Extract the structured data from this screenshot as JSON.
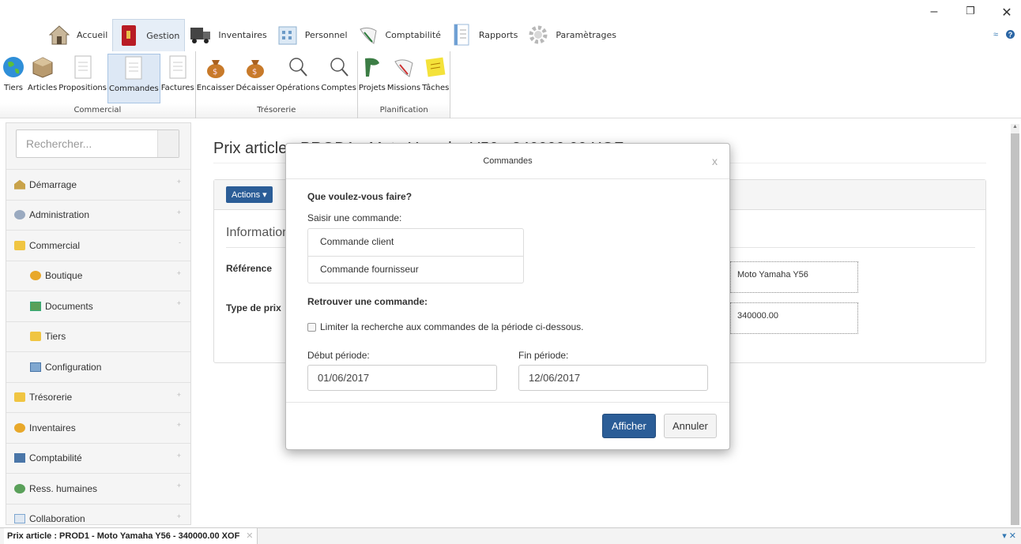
{
  "window_controls": {
    "minimize": "–",
    "restore": "❐",
    "close": "✕"
  },
  "topmenu": [
    {
      "label": "Accueil",
      "icon": "home-icon"
    },
    {
      "label": "Gestion",
      "icon": "book-icon"
    },
    {
      "label": "Inventaires",
      "icon": "truck-icon"
    },
    {
      "label": "Personnel",
      "icon": "building-icon"
    },
    {
      "label": "Comptabilité",
      "icon": "pen-icon"
    },
    {
      "label": "Rapports",
      "icon": "report-icon"
    },
    {
      "label": "Paramètrages",
      "icon": "gear-icon"
    }
  ],
  "ribbon": {
    "groups": [
      {
        "label": "Commercial",
        "buttons": [
          "Tiers",
          "Articles",
          "Propositions",
          "Commandes",
          "Factures"
        ]
      },
      {
        "label": "Trésorerie",
        "buttons": [
          "Encaisser",
          "Décaisser",
          "Opérations",
          "Comptes"
        ]
      },
      {
        "label": "Planification",
        "buttons": [
          "Projets",
          "Missions",
          "Tâches"
        ]
      }
    ],
    "selected": "Commandes"
  },
  "sidebar": {
    "search_placeholder": "Rechercher...",
    "items": [
      {
        "label": "Démarrage",
        "icon": "home-icon"
      },
      {
        "label": "Administration",
        "icon": "gear-icon"
      },
      {
        "label": "Commercial",
        "icon": "folder-icon"
      },
      {
        "label": "Boutique",
        "icon": "box-icon"
      },
      {
        "label": "Documents",
        "icon": "document-icon"
      },
      {
        "label": "Tiers",
        "icon": "folder-icon"
      },
      {
        "label": "Configuration",
        "icon": "monitor-icon"
      },
      {
        "label": "Trésorerie",
        "icon": "folder-icon"
      },
      {
        "label": "Inventaires",
        "icon": "box-icon"
      },
      {
        "label": "Comptabilité",
        "icon": "chart-icon"
      },
      {
        "label": "Ress. humaines",
        "icon": "people-icon"
      },
      {
        "label": "Collaboration",
        "icon": "monitor-icon"
      }
    ]
  },
  "page": {
    "title": "Prix article : PROD1 - Moto Yamaha Y56 - 340000.00 XOF",
    "actions_label": "Actions ▾",
    "section": "Information",
    "fields": [
      {
        "label": "Référence",
        "value": "Moto Yamaha Y56"
      },
      {
        "label": "Type de prix",
        "value": "340000.00"
      }
    ]
  },
  "modal": {
    "title": "Commandes",
    "close": "x",
    "question": "Que voulez-vous faire?",
    "enter_label": "Saisir une commande:",
    "options": [
      "Commande client",
      "Commande fournisseur"
    ],
    "find_label": "Retrouver une commande:",
    "checkbox_label": "Limiter la recherche aux commandes de la période ci-dessous.",
    "start_label": "Début période:",
    "start_value": "01/06/2017",
    "end_label": "Fin période:",
    "end_value": "12/06/2017",
    "primary_button": "Afficher",
    "cancel_button": "Annuler"
  },
  "bottom_tab": {
    "label": "Prix article : PROD1 - Moto Yamaha Y56 - 340000.00 XOF",
    "close": "✕",
    "controls": "▾ ✕"
  }
}
